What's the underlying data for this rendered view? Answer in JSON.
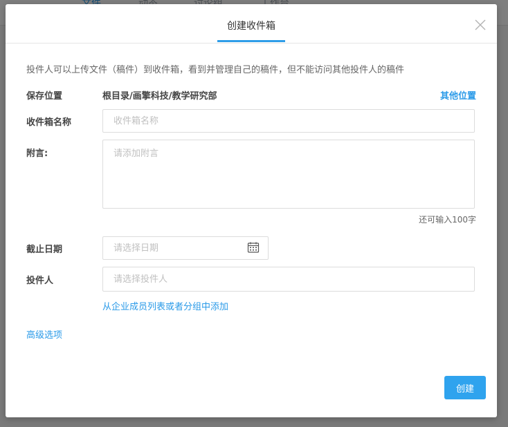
{
  "background": {
    "tabs": [
      "文件",
      "动态",
      "讨论组",
      "工作台"
    ],
    "active_tab_index": 0
  },
  "dialog": {
    "title": "创建收件箱",
    "description": "投件人可以上传文件（稿件）到收件箱，看到并管理自己的稿件，但不能访问其他投件人的稿件",
    "save_location": {
      "label": "保存位置",
      "value": "根目录/画擎科技/教学研究部",
      "other_link": "其他位置"
    },
    "inbox_name": {
      "label": "收件箱名称",
      "placeholder": "收件箱名称",
      "value": ""
    },
    "note": {
      "label": "附言:",
      "placeholder": "请添加附言",
      "value": "",
      "remaining": "还可输入100字"
    },
    "deadline": {
      "label": "截止日期",
      "placeholder": "请选择日期",
      "icon": "calendar-icon"
    },
    "submitters": {
      "label": "投件人",
      "placeholder": "请选择投件人",
      "add_link": "从企业成员列表或者分组中添加"
    },
    "advanced_link": "高级选项",
    "create_button": "创建",
    "close_icon": "close-icon"
  },
  "colors": {
    "accent": "#2fa3ee",
    "link": "#2a9ae8",
    "overlay": "rgba(0,0,0,0.5)"
  }
}
